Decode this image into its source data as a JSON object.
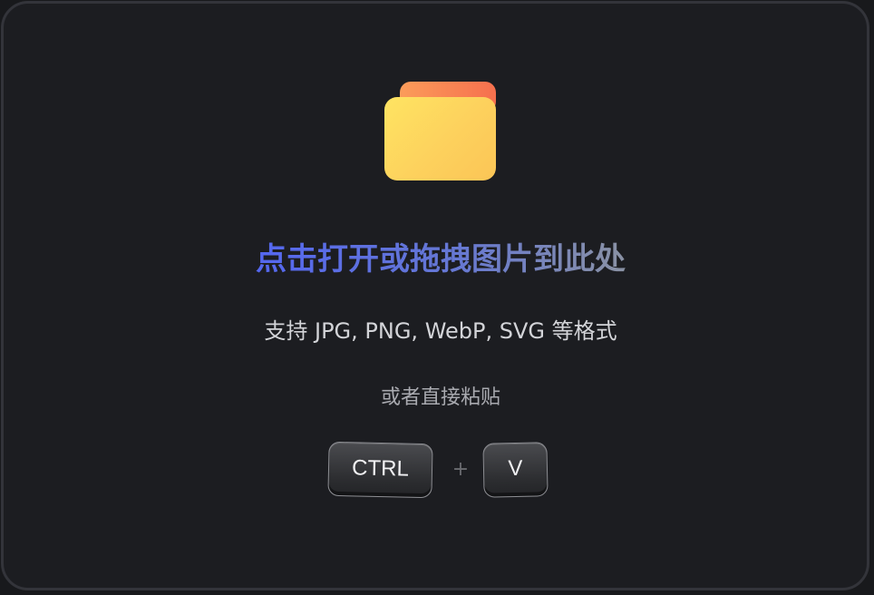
{
  "dropzone": {
    "title": "点击打开或拖拽图片到此处",
    "formats": "支持 JPG, PNG, WebP, SVG 等格式",
    "paste_hint": "或者直接粘贴",
    "icon": "folder-icon"
  },
  "shortcut": {
    "key1": "CTRL",
    "separator": "+",
    "key2": "V"
  },
  "colors": {
    "background": "#1c1d21",
    "border": "#33343a",
    "title_gradient_start": "#5467f0",
    "title_gradient_end": "#8a92a4",
    "folder_tab": "#f6704e",
    "folder_body": "#fee462"
  }
}
